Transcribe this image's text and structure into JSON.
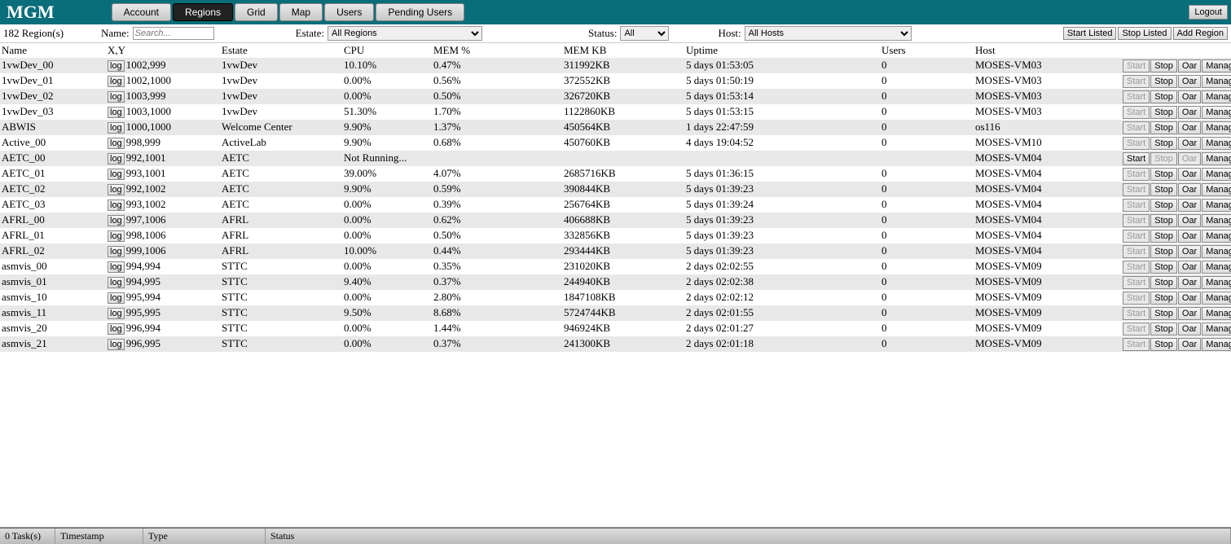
{
  "app": {
    "logo": "MGM",
    "logout": "Logout"
  },
  "tabs": [
    {
      "label": "Account",
      "active": false
    },
    {
      "label": "Regions",
      "active": true
    },
    {
      "label": "Grid",
      "active": false
    },
    {
      "label": "Map",
      "active": false
    },
    {
      "label": "Users",
      "active": false
    },
    {
      "label": "Pending Users",
      "active": false
    }
  ],
  "filter": {
    "count": "182 Region(s)",
    "name_label": "Name:",
    "search_placeholder": "Search...",
    "estate_label": "Estate:",
    "estate_selected": "All Regions",
    "status_label": "Status:",
    "status_selected": "All",
    "host_label": "Host:",
    "host_selected": "All Hosts",
    "btn_start_listed": "Start Listed",
    "btn_stop_listed": "Stop Listed",
    "btn_add_region": "Add Region"
  },
  "columns": {
    "name": "Name",
    "xy": "X,Y",
    "estate": "Estate",
    "cpu": "CPU",
    "mem": "MEM %",
    "memkb": "MEM KB",
    "uptime": "Uptime",
    "users": "Users",
    "host": "Host"
  },
  "row_buttons": {
    "log": "log",
    "start": "Start",
    "stop": "Stop",
    "oar": "Oar",
    "manage": "Manage"
  },
  "rows": [
    {
      "name": "1vwDev_00",
      "xy": "1002,999",
      "estate": "1vwDev",
      "cpu": "10.10%",
      "mem": "0.47%",
      "memkb": "311992KB",
      "uptime": "5 days 01:53:05",
      "users": "0",
      "host": "MOSES-VM03",
      "running": true
    },
    {
      "name": "1vwDev_01",
      "xy": "1002,1000",
      "estate": "1vwDev",
      "cpu": "0.00%",
      "mem": "0.56%",
      "memkb": "372552KB",
      "uptime": "5 days 01:50:19",
      "users": "0",
      "host": "MOSES-VM03",
      "running": true
    },
    {
      "name": "1vwDev_02",
      "xy": "1003,999",
      "estate": "1vwDev",
      "cpu": "0.00%",
      "mem": "0.50%",
      "memkb": "326720KB",
      "uptime": "5 days 01:53:14",
      "users": "0",
      "host": "MOSES-VM03",
      "running": true
    },
    {
      "name": "1vwDev_03",
      "xy": "1003,1000",
      "estate": "1vwDev",
      "cpu": "51.30%",
      "mem": "1.70%",
      "memkb": "1122860KB",
      "uptime": "5 days 01:53:15",
      "users": "0",
      "host": "MOSES-VM03",
      "running": true
    },
    {
      "name": "ABWIS",
      "xy": "1000,1000",
      "estate": "Welcome Center",
      "cpu": "9.90%",
      "mem": "1.37%",
      "memkb": "450564KB",
      "uptime": "1 days 22:47:59",
      "users": "0",
      "host": "os116",
      "running": true
    },
    {
      "name": "Active_00",
      "xy": "998,999",
      "estate": "ActiveLab",
      "cpu": "9.90%",
      "mem": "0.68%",
      "memkb": "450760KB",
      "uptime": "4 days 19:04:52",
      "users": "0",
      "host": "MOSES-VM10",
      "running": true
    },
    {
      "name": "AETC_00",
      "xy": "992,1001",
      "estate": "AETC",
      "cpu": "Not Running...",
      "mem": "",
      "memkb": "",
      "uptime": "",
      "users": "",
      "host": "MOSES-VM04",
      "running": false
    },
    {
      "name": "AETC_01",
      "xy": "993,1001",
      "estate": "AETC",
      "cpu": "39.00%",
      "mem": "4.07%",
      "memkb": "2685716KB",
      "uptime": "5 days 01:36:15",
      "users": "0",
      "host": "MOSES-VM04",
      "running": true
    },
    {
      "name": "AETC_02",
      "xy": "992,1002",
      "estate": "AETC",
      "cpu": "9.90%",
      "mem": "0.59%",
      "memkb": "390844KB",
      "uptime": "5 days 01:39:23",
      "users": "0",
      "host": "MOSES-VM04",
      "running": true
    },
    {
      "name": "AETC_03",
      "xy": "993,1002",
      "estate": "AETC",
      "cpu": "0.00%",
      "mem": "0.39%",
      "memkb": "256764KB",
      "uptime": "5 days 01:39:24",
      "users": "0",
      "host": "MOSES-VM04",
      "running": true
    },
    {
      "name": "AFRL_00",
      "xy": "997,1006",
      "estate": "AFRL",
      "cpu": "0.00%",
      "mem": "0.62%",
      "memkb": "406688KB",
      "uptime": "5 days 01:39:23",
      "users": "0",
      "host": "MOSES-VM04",
      "running": true
    },
    {
      "name": "AFRL_01",
      "xy": "998,1006",
      "estate": "AFRL",
      "cpu": "0.00%",
      "mem": "0.50%",
      "memkb": "332856KB",
      "uptime": "5 days 01:39:23",
      "users": "0",
      "host": "MOSES-VM04",
      "running": true
    },
    {
      "name": "AFRL_02",
      "xy": "999,1006",
      "estate": "AFRL",
      "cpu": "10.00%",
      "mem": "0.44%",
      "memkb": "293444KB",
      "uptime": "5 days 01:39:23",
      "users": "0",
      "host": "MOSES-VM04",
      "running": true
    },
    {
      "name": "asmvis_00",
      "xy": "994,994",
      "estate": "STTC",
      "cpu": "0.00%",
      "mem": "0.35%",
      "memkb": "231020KB",
      "uptime": "2 days 02:02:55",
      "users": "0",
      "host": "MOSES-VM09",
      "running": true
    },
    {
      "name": "asmvis_01",
      "xy": "994,995",
      "estate": "STTC",
      "cpu": "9.40%",
      "mem": "0.37%",
      "memkb": "244940KB",
      "uptime": "2 days 02:02:38",
      "users": "0",
      "host": "MOSES-VM09",
      "running": true
    },
    {
      "name": "asmvis_10",
      "xy": "995,994",
      "estate": "STTC",
      "cpu": "0.00%",
      "mem": "2.80%",
      "memkb": "1847108KB",
      "uptime": "2 days 02:02:12",
      "users": "0",
      "host": "MOSES-VM09",
      "running": true
    },
    {
      "name": "asmvis_11",
      "xy": "995,995",
      "estate": "STTC",
      "cpu": "9.50%",
      "mem": "8.68%",
      "memkb": "5724744KB",
      "uptime": "2 days 02:01:55",
      "users": "0",
      "host": "MOSES-VM09",
      "running": true
    },
    {
      "name": "asmvis_20",
      "xy": "996,994",
      "estate": "STTC",
      "cpu": "0.00%",
      "mem": "1.44%",
      "memkb": "946924KB",
      "uptime": "2 days 02:01:27",
      "users": "0",
      "host": "MOSES-VM09",
      "running": true
    },
    {
      "name": "asmvis_21",
      "xy": "996,995",
      "estate": "STTC",
      "cpu": "0.00%",
      "mem": "0.37%",
      "memkb": "241300KB",
      "uptime": "2 days 02:01:18",
      "users": "0",
      "host": "MOSES-VM09",
      "running": true
    }
  ],
  "footer": {
    "tasks": "0 Task(s)",
    "timestamp": "Timestamp",
    "type": "Type",
    "status": "Status"
  }
}
